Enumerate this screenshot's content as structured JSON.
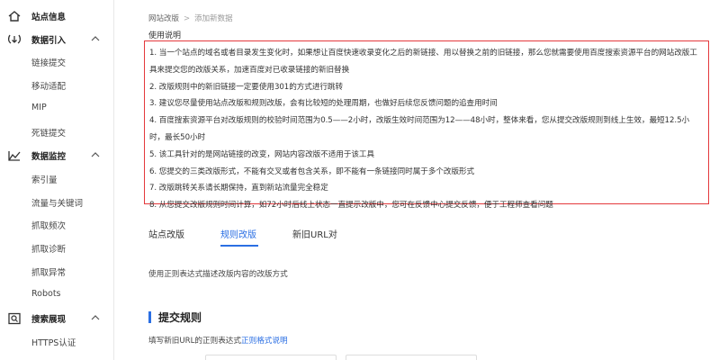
{
  "sidebar": {
    "sections": [
      {
        "label": "站点信息",
        "icon": "home-icon"
      },
      {
        "label": "数据引入",
        "icon": "data-import-icon",
        "items": [
          "链接提交",
          "移动适配",
          "MIP",
          "死链提交"
        ]
      },
      {
        "label": "数据监控",
        "icon": "monitor-icon",
        "items": [
          "索引量",
          "流量与关键词",
          "抓取频次",
          "抓取诊断",
          "抓取异常",
          "Robots"
        ]
      },
      {
        "label": "搜索展现",
        "icon": "search-display-icon",
        "items": [
          "HTTPS认证"
        ]
      }
    ]
  },
  "breadcrumb": {
    "parent": "网站改版",
    "separator": ">",
    "current": "添加新数据"
  },
  "usage": {
    "title": "使用说明",
    "items": [
      "1. 当一个站点的域名或者目录发生变化时，如果想让百度快速收录变化之后的新链接、用以替换之前的旧链接，那么您就需要使用百度搜索资源平台的网站改版工具来提交您的改版关系，加速百度对已收录链接的新旧替换",
      "2. 改版规则中的新旧链接一定要使用301的方式进行跳转",
      "3. 建议您尽量使用站点改版和规则改版，会有比较短的处理周期，也做好后续您反馈问题的追查用时间",
      "4. 百度搜索资源平台对改版规则的校验时间范围为0.5——2小时，改版生效时间范围为12——48小时，整体来看，您从提交改版规则到线上生效，最短12.5小时，最长50小时",
      "5. 该工具针对的是网站链接的改变，网站内容改版不适用于该工具",
      "6. 您提交的三类改版形式，不能有交叉或者包含关系，即不能有一条链接同时属于多个改版形式",
      "7. 改版跳转关系请长期保持，直到新站流量完全稳定",
      "8. 从您提交改版规则时间计算，如72小时后线上状态一直提示改版中，您可在反馈中心提交反馈，便于工程师查看问题"
    ]
  },
  "tabs": [
    {
      "label": "站点改版",
      "active": false
    },
    {
      "label": "规则改版",
      "active": true
    },
    {
      "label": "新旧URL对",
      "active": false
    }
  ],
  "description": "使用正则表达式描述改版内容的改版方式",
  "section_title": "提交规则",
  "hint": {
    "text": "填写新旧URL的正则表达式",
    "link": "正则格式说明"
  },
  "colors": {
    "accent": "#2b6fe3",
    "notice_border": "#e4393c"
  }
}
